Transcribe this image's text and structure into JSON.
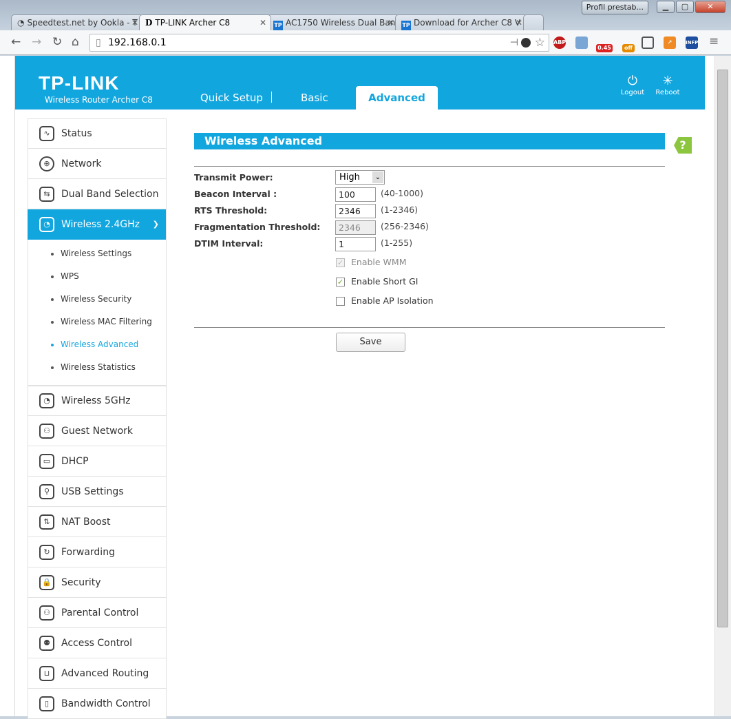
{
  "browser": {
    "profile_label": "Profil prestab...",
    "tabs": [
      {
        "title": "Speedtest.net by Ookla - T",
        "icon": "speedometer-icon"
      },
      {
        "title": "TP-LINK Archer C8",
        "icon": "d-icon"
      },
      {
        "title": "AC1750 Wireless Dual Ban",
        "icon": "tp-icon"
      },
      {
        "title": "Download for Archer C8 V",
        "icon": "tp-icon"
      }
    ],
    "url": "192.168.0.1",
    "extensions": {
      "abp": "ABP",
      "speed": "0.45",
      "off": "off",
      "infp": "INFP"
    }
  },
  "header": {
    "logo": "TP-LINK",
    "model": "Wireless Router Archer C8",
    "tabs": [
      "Quick Setup",
      "Basic",
      "Advanced"
    ],
    "logout": "Logout",
    "reboot": "Reboot"
  },
  "sidebar": {
    "items_top": [
      {
        "label": "Status",
        "icon": "∿"
      },
      {
        "label": "Network",
        "icon": "⊕"
      },
      {
        "label": "Dual Band Selection",
        "icon": "⇆"
      },
      {
        "label": "Wireless 2.4GHz",
        "icon": "◔"
      }
    ],
    "sub": [
      "Wireless Settings",
      "WPS",
      "Wireless Security",
      "Wireless MAC Filtering",
      "Wireless Advanced",
      "Wireless Statistics"
    ],
    "items_bottom": [
      {
        "label": "Wireless 5GHz",
        "icon": "◔"
      },
      {
        "label": "Guest Network",
        "icon": "⚇"
      },
      {
        "label": "DHCP",
        "icon": "▭"
      },
      {
        "label": "USB Settings",
        "icon": "⚲"
      },
      {
        "label": "NAT Boost",
        "icon": "⇅"
      },
      {
        "label": "Forwarding",
        "icon": "↻"
      },
      {
        "label": "Security",
        "icon": "🔒"
      },
      {
        "label": "Parental Control",
        "icon": "⚇"
      },
      {
        "label": "Access Control",
        "icon": "⚉"
      },
      {
        "label": "Advanced Routing",
        "icon": "⊔"
      },
      {
        "label": "Bandwidth Control",
        "icon": "▯"
      }
    ]
  },
  "content": {
    "title": "Wireless Advanced",
    "help": "?",
    "transmit_power": {
      "label": "Transmit Power:",
      "value": "High"
    },
    "beacon": {
      "label": "Beacon Interval :",
      "value": "100",
      "range": "(40-1000)"
    },
    "rts": {
      "label": "RTS Threshold:",
      "value": "2346",
      "range": "(1-2346)"
    },
    "frag": {
      "label": "Fragmentation Threshold:",
      "value": "2346",
      "range": "(256-2346)"
    },
    "dtim": {
      "label": "DTIM Interval:",
      "value": "1",
      "range": "(1-255)"
    },
    "wmm": {
      "label": "Enable WMM",
      "checked": true,
      "disabled": true
    },
    "short_gi": {
      "label": "Enable Short GI",
      "checked": true
    },
    "ap_isolation": {
      "label": "Enable AP Isolation",
      "checked": false
    },
    "save": "Save"
  }
}
